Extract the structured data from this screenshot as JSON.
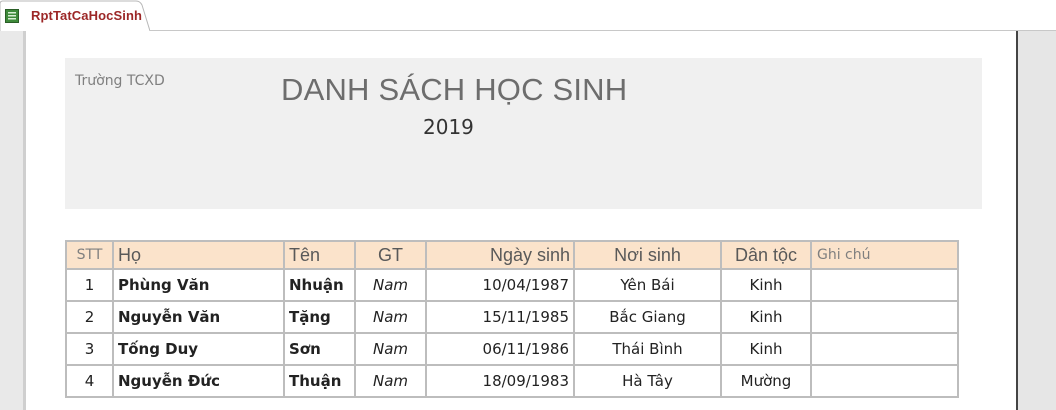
{
  "tab": {
    "label": "RptTatCaHocSinh",
    "icon": "report-icon"
  },
  "report": {
    "school": "Trường TCXD",
    "title": "DANH SÁCH HỌC SINH",
    "year": "2019"
  },
  "table": {
    "headers": {
      "stt": "STT",
      "ho": "Họ",
      "ten": "Tên",
      "gt": "GT",
      "ngay_sinh": "Ngày sinh",
      "noi_sinh": "Nơi sinh",
      "dan_toc": "Dân tộc",
      "ghi_chu": "Ghi  chú"
    },
    "rows": [
      {
        "stt": "1",
        "ho": "Phùng Văn",
        "ten": "Nhuận",
        "gt": "Nam",
        "ngay_sinh": "10/04/1987",
        "noi_sinh": "Yên Bái",
        "dan_toc": "Kinh",
        "ghi_chu": ""
      },
      {
        "stt": "2",
        "ho": "Nguyễn Văn",
        "ten": "Tặng",
        "gt": "Nam",
        "ngay_sinh": "15/11/1985",
        "noi_sinh": "Bắc Giang",
        "dan_toc": "Kinh",
        "ghi_chu": ""
      },
      {
        "stt": "3",
        "ho": "Tống Duy",
        "ten": "Sơn",
        "gt": "Nam",
        "ngay_sinh": "06/11/1986",
        "noi_sinh": "Thái Bình",
        "dan_toc": "Kinh",
        "ghi_chu": ""
      },
      {
        "stt": "4",
        "ho": "Nguyễn Đức",
        "ten": "Thuận",
        "gt": "Nam",
        "ngay_sinh": "18/09/1983",
        "noi_sinh": "Hà Tây",
        "dan_toc": "Mường",
        "ghi_chu": ""
      }
    ]
  },
  "colors": {
    "tab_text": "#9c2727",
    "header_fill": "#fbe3cb",
    "band": "#f0f0f0"
  }
}
